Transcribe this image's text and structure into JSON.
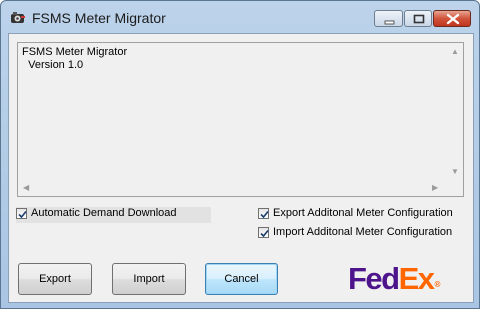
{
  "window": {
    "title": "FSMS Meter Migrator",
    "icon": "app-gear-icon",
    "controls": [
      "minimize-icon",
      "maximize-icon",
      "close-icon"
    ]
  },
  "text_panel": {
    "content": "FSMS Meter Migrator\n  Version 1.0"
  },
  "options": {
    "auto_demand": {
      "label": "Automatic Demand Download",
      "checked": true
    },
    "export_config": {
      "label": "Export Additonal Meter Configuration",
      "checked": true
    },
    "import_config": {
      "label": "Import Additonal Meter Configuration",
      "checked": true
    }
  },
  "buttons": {
    "export": "Export",
    "import": "Import",
    "cancel": "Cancel"
  },
  "logo": {
    "part1": "Fed",
    "part2": "Ex",
    "mark": "®",
    "colors": {
      "fed": "#4d148c",
      "ex": "#ff6600"
    }
  }
}
